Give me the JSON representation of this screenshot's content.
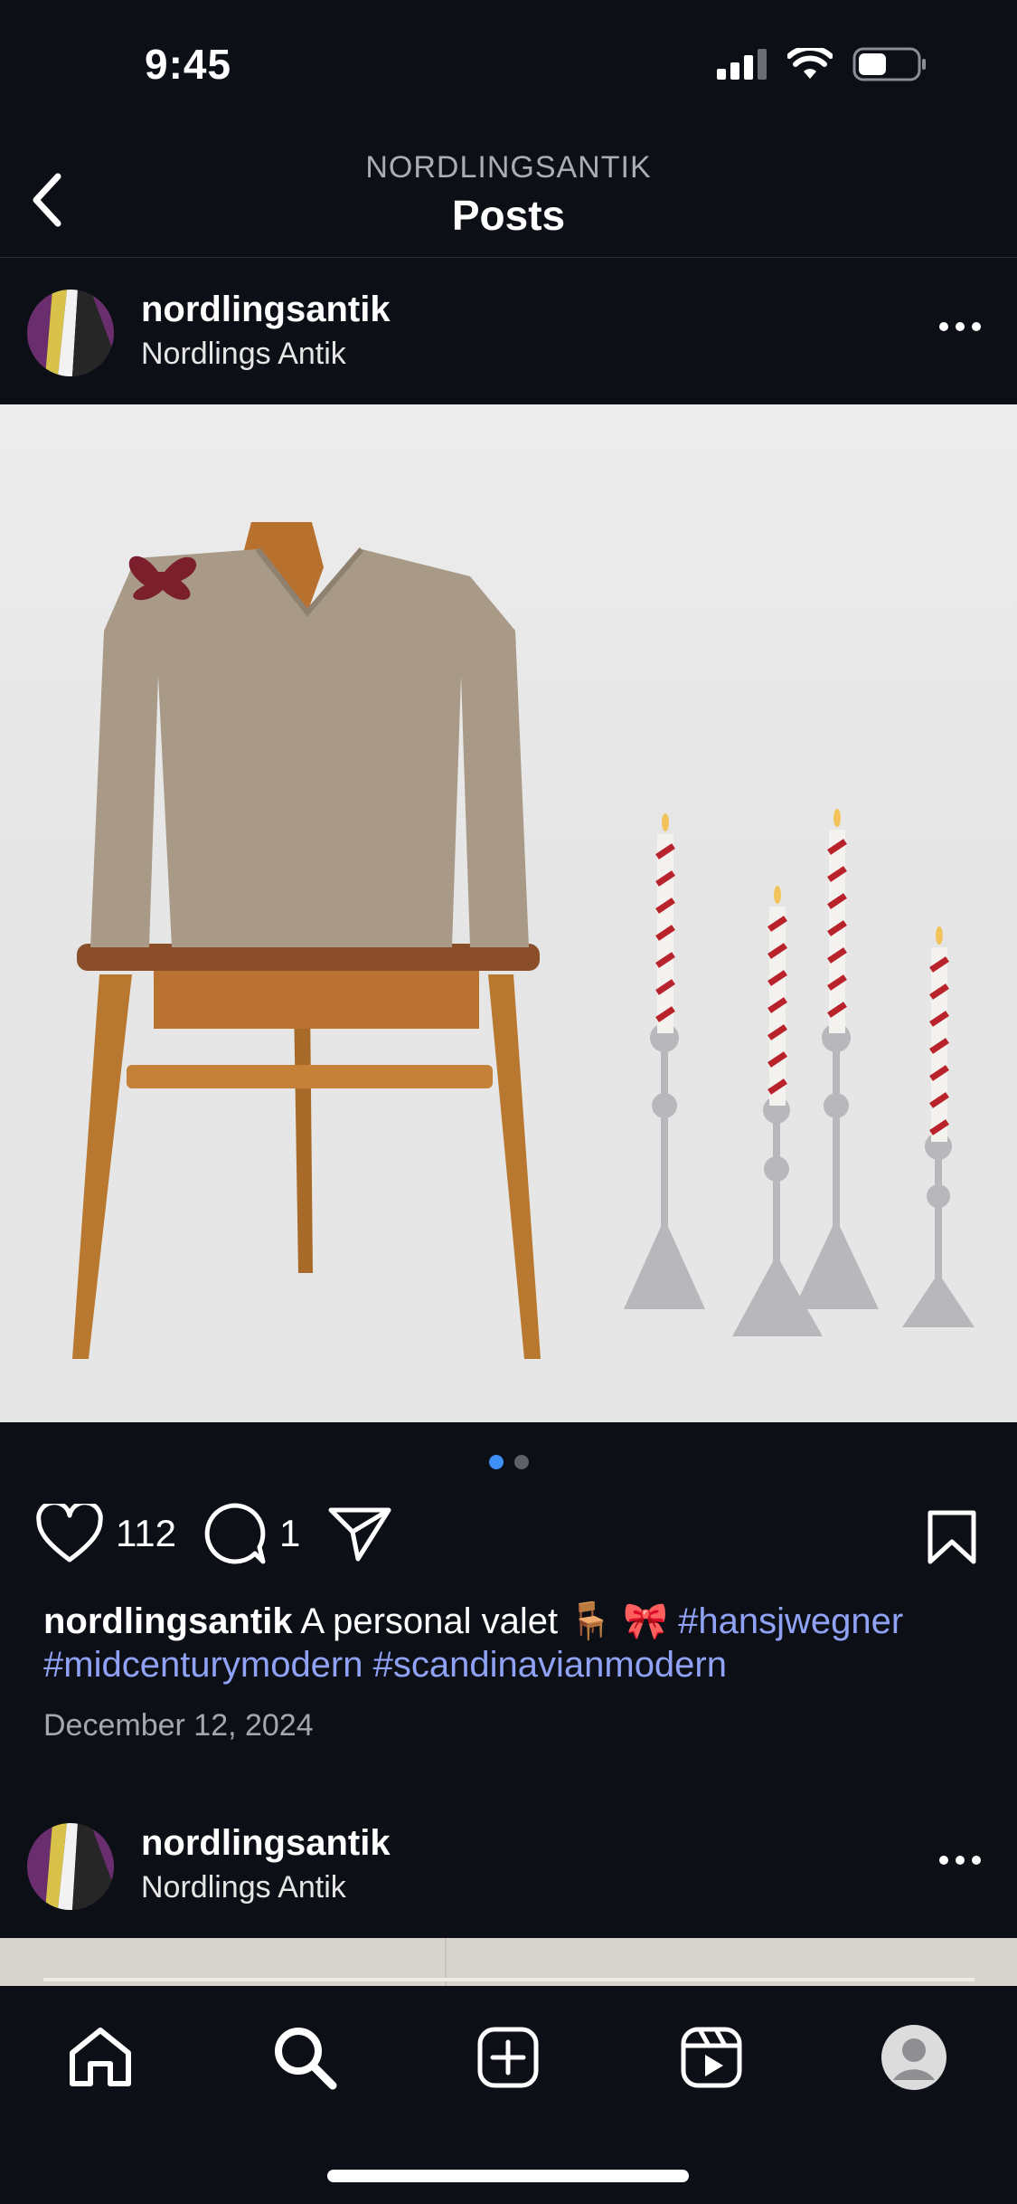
{
  "status_bar": {
    "time": "9:45",
    "icons": [
      "signal-icon",
      "wifi-icon",
      "battery-icon"
    ]
  },
  "header": {
    "subtitle": "NORDLINGSANTIK",
    "title": "Posts"
  },
  "posts": [
    {
      "username": "nordlingsantik",
      "display_name": "Nordlings Antik",
      "image_pages": 2,
      "active_page": 1,
      "likes": "112",
      "comments": "1",
      "caption_user": "nordlingsantik",
      "caption_text": "A personal valet 🪑 🎀",
      "hashtags": [
        "#hansjwegner",
        "#midcenturymodern",
        "#scandinavianmodern"
      ],
      "date": "December 12, 2024"
    },
    {
      "username": "nordlingsantik",
      "display_name": "Nordlings Antik"
    }
  ],
  "tab_bar": [
    "home-icon",
    "search-icon",
    "create-icon",
    "reels-icon",
    "profile-icon"
  ],
  "colors": {
    "background": "#0c0f16",
    "hashtag": "#8fa2f5",
    "active_dot": "#3d8ef5"
  }
}
